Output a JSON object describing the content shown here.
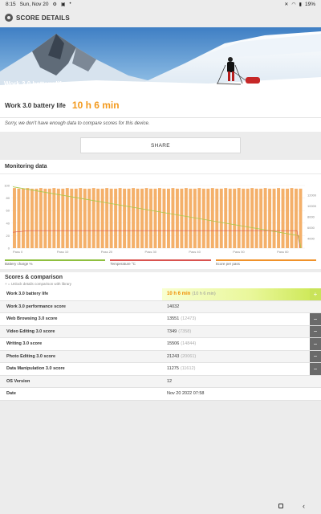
{
  "status_bar": {
    "time": "8:15",
    "date": "Sun, Nov 20",
    "battery": "19%",
    "icons": [
      "settings-icon",
      "image-icon",
      "dot-icon",
      "mute-icon",
      "wifi-icon",
      "battery-icon"
    ]
  },
  "app_bar": {
    "title": "SCORE DETAILS",
    "icon": "ul-logo-icon"
  },
  "hero": {
    "label": "Work 3.0 battery life",
    "arrow": ">>"
  },
  "result": {
    "name": "Work 3.0 battery life",
    "value": "10 h 6 min"
  },
  "compare_note": "Sorry, we don't have enough data to compare scores for this device.",
  "share": {
    "label": "SHARE"
  },
  "monitoring": {
    "title": "Monitoring data",
    "legend": [
      {
        "label": "Battery charge %",
        "color": "#8fbf3f"
      },
      {
        "label": "Temperature °C",
        "color": "#d9534f"
      },
      {
        "label": "Score per pass",
        "color": "#f0922a"
      }
    ]
  },
  "chart_data": {
    "type": "bar",
    "y_left_ticks": [
      "100",
      "80",
      "60",
      "40",
      "20",
      "0"
    ],
    "y_left_range": [
      0,
      100
    ],
    "y_right_ticks": [
      "12000",
      "10000",
      "8000",
      "6000",
      "4000"
    ],
    "x_ticks": [
      "Pass 0",
      "Pass 10",
      "Pass 20",
      "Pass 30",
      "Pass 40",
      "Pass 50",
      "Pass 60"
    ],
    "passes": 66,
    "score_per_pass_approx": 95,
    "battery_start": 98,
    "battery_end": 20,
    "temperature_approx": 28,
    "series": [
      {
        "name": "Battery charge %",
        "color": "#8fbf3f"
      },
      {
        "name": "Temperature °C",
        "color": "#d9534f"
      },
      {
        "name": "Score per pass",
        "color": "#f0922a"
      }
    ]
  },
  "scores": {
    "title": "Scores & comparison",
    "subtitle": "+ = Unlock details comparison with library",
    "rows": [
      {
        "key": "Work 3.0 battery life",
        "value": "10 h 6 min",
        "sub": "(10 h 6 min)",
        "expand": "+"
      },
      {
        "key": "Work 3.0 performance score",
        "value": "14032",
        "sub": "",
        "expand": ""
      },
      {
        "key": "Web Browsing 3.0 score",
        "value": "13551",
        "sub": "(12473)",
        "expand": "−"
      },
      {
        "key": "Video Editing 3.0 score",
        "value": "7349",
        "sub": "(7358)",
        "expand": "−"
      },
      {
        "key": "Writing 3.0 score",
        "value": "15506",
        "sub": "(14844)",
        "expand": "−"
      },
      {
        "key": "Photo Editing 3.0 score",
        "value": "21243",
        "sub": "(20061)",
        "expand": "−"
      },
      {
        "key": "Data Manipulation 3.0 score",
        "value": "11275",
        "sub": "(11612)",
        "expand": "−"
      },
      {
        "key": "OS Version",
        "value": "12",
        "sub": "",
        "expand": ""
      },
      {
        "key": "Date",
        "value": "Nov 20 2022 07:58",
        "sub": "",
        "expand": ""
      }
    ]
  },
  "nav": {
    "back": "‹"
  }
}
